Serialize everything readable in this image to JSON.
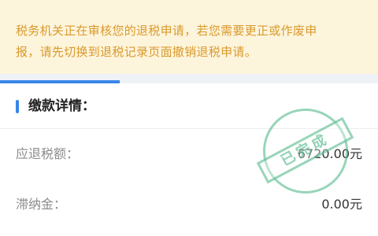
{
  "notice": {
    "line1": "税务机关正在审核您的退税申请，若您需要更正或作废申",
    "line2": "报，请先切换到退税记录页面撤销退税申请。"
  },
  "section": {
    "title": "缴款详情："
  },
  "rows": [
    {
      "label": "应退税额：",
      "value": "6720.00元"
    },
    {
      "label": "滞纳金：",
      "value": "0.00元"
    }
  ],
  "stamp": {
    "text": "已完成"
  },
  "colors": {
    "notice_bg": "#fdf4dc",
    "notice_text": "#d99a2b",
    "accent": "#3a86e8",
    "stamp": "#44b280"
  }
}
